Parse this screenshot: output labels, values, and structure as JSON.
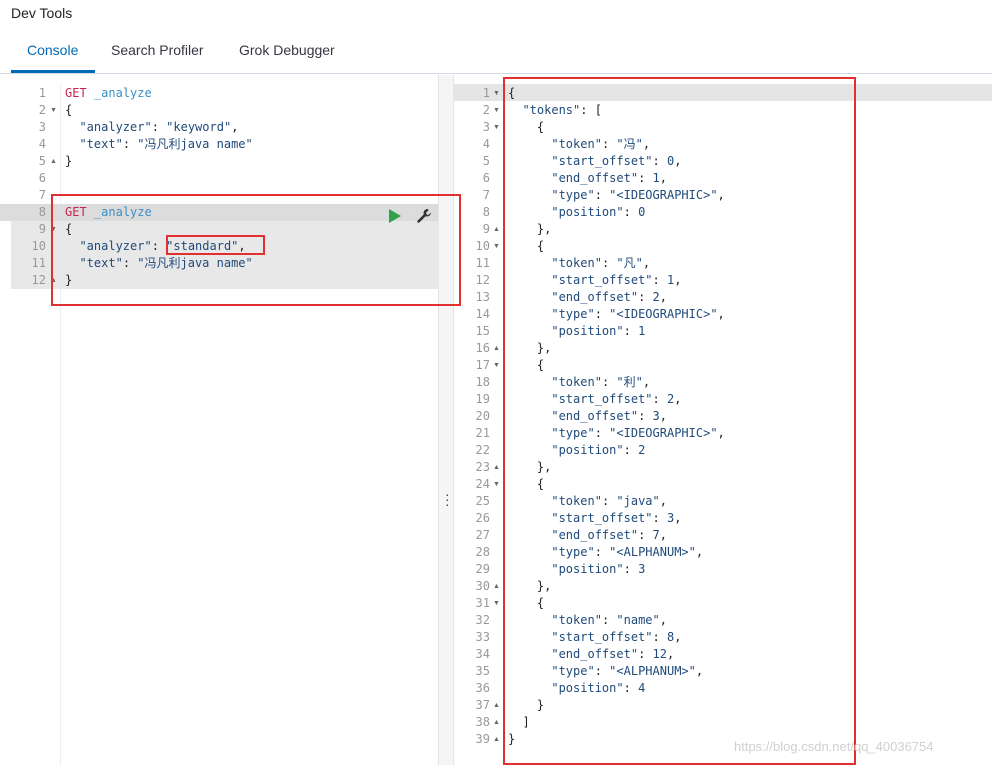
{
  "app": {
    "title": "Dev Tools"
  },
  "tabs": [
    {
      "label": "Console"
    },
    {
      "label": "Search Profiler"
    },
    {
      "label": "Grok Debugger"
    }
  ],
  "request": {
    "line_numbers": [
      "1",
      "2",
      "3",
      "4",
      "5",
      "6",
      "7",
      "8",
      "9",
      "10",
      "11",
      "12"
    ],
    "block1": {
      "method": "GET",
      "path": "_analyze",
      "open": "{",
      "analyzer_key": "\"analyzer\"",
      "analyzer_val": "\"keyword\"",
      "text_key": "\"text\"",
      "text_val": "\"冯凡利java name\"",
      "close": "}"
    },
    "block2": {
      "method": "GET",
      "path": "_analyze",
      "open": "{",
      "analyzer_key": "\"analyzer\"",
      "analyzer_val": "\"standard\"",
      "text_key": "\"text\"",
      "text_val": "\"冯凡利java name\"",
      "close": "}"
    }
  },
  "response": {
    "tokens_key": "\"tokens\"",
    "tokens": [
      {
        "token": "\"冯\"",
        "start_offset": "0",
        "end_offset": "1",
        "type": "\"<IDEOGRAPHIC>\"",
        "position": "0"
      },
      {
        "token": "\"凡\"",
        "start_offset": "1",
        "end_offset": "2",
        "type": "\"<IDEOGRAPHIC>\"",
        "position": "1"
      },
      {
        "token": "\"利\"",
        "start_offset": "2",
        "end_offset": "3",
        "type": "\"<IDEOGRAPHIC>\"",
        "position": "2"
      },
      {
        "token": "\"java\"",
        "start_offset": "3",
        "end_offset": "7",
        "type": "\"<ALPHANUM>\"",
        "position": "3"
      },
      {
        "token": "\"name\"",
        "start_offset": "8",
        "end_offset": "12",
        "type": "\"<ALPHANUM>\"",
        "position": "4"
      }
    ]
  },
  "watermark": "https://blog.csdn.net/qq_40036754",
  "colors": {
    "accent": "#006bb4",
    "highlight_box": "#e03030",
    "run": "#2fa24a"
  },
  "icons": {
    "run": "play-icon",
    "settings": "wrench-icon",
    "resize": "vertical-dots-icon"
  }
}
